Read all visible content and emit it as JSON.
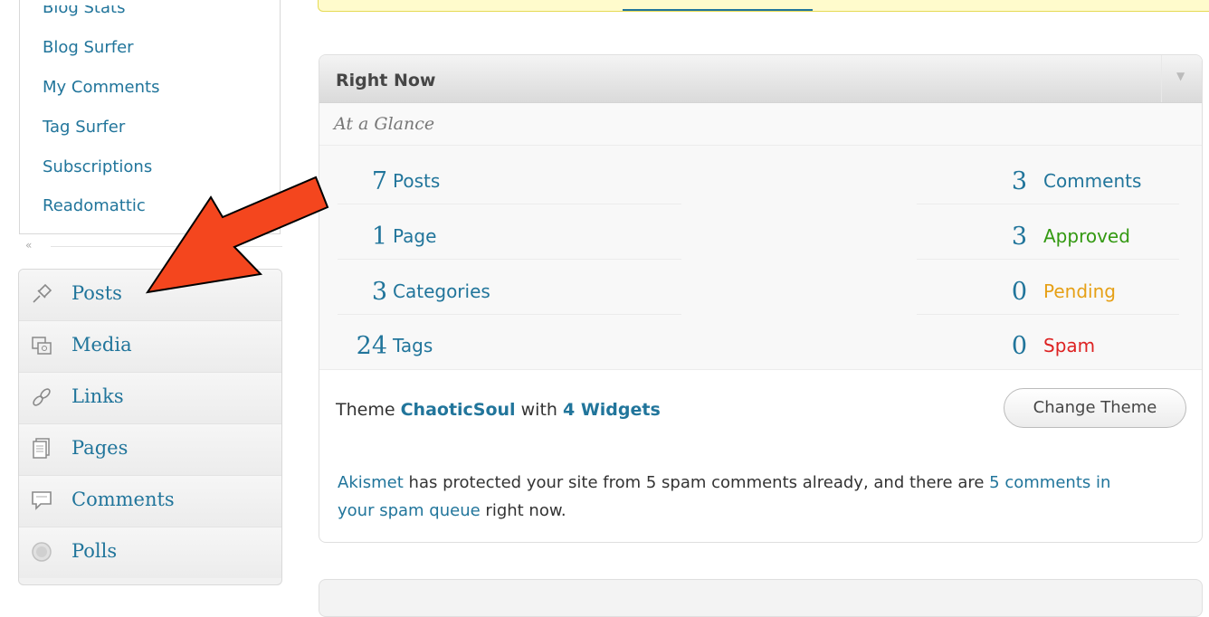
{
  "submenu": {
    "items": [
      {
        "label": "Blog Stats"
      },
      {
        "label": "Blog Surfer"
      },
      {
        "label": "My Comments"
      },
      {
        "label": "Tag Surfer"
      },
      {
        "label": "Subscriptions"
      },
      {
        "label": "Readomattic"
      }
    ],
    "collapse": "«"
  },
  "menu": {
    "items": [
      {
        "label": "Posts",
        "icon": "pin-icon"
      },
      {
        "label": "Media",
        "icon": "media-icon"
      },
      {
        "label": "Links",
        "icon": "link-icon"
      },
      {
        "label": "Pages",
        "icon": "pages-icon"
      },
      {
        "label": "Comments",
        "icon": "comment-icon"
      },
      {
        "label": "Polls",
        "icon": "poll-icon"
      }
    ]
  },
  "right_now": {
    "title": "Right Now",
    "toggle": "▼",
    "subtitle": "At a Glance",
    "content": [
      {
        "count": "7",
        "label": "Posts"
      },
      {
        "count": "1",
        "label": "Page"
      },
      {
        "count": "3",
        "label": "Categories"
      },
      {
        "count": "24",
        "label": "Tags"
      }
    ],
    "discussion": [
      {
        "count": "3",
        "label": "Comments",
        "status": "default"
      },
      {
        "count": "3",
        "label": "Approved",
        "status": "approved"
      },
      {
        "count": "0",
        "label": "Pending",
        "status": "pending"
      },
      {
        "count": "0",
        "label": "Spam",
        "status": "spam"
      }
    ],
    "theme": {
      "prefix": "Theme",
      "name": "ChaoticSoul",
      "with": "with",
      "widgets": "4 Widgets",
      "button": "Change Theme"
    },
    "akismet": {
      "link": "Akismet",
      "text1": "has protected your site from 5 spam comments already, and there are",
      "queue_link_1": "5",
      "queue_link_2": "comments in your spam queue",
      "text2": "right now."
    }
  },
  "colors": {
    "link": "#21759b",
    "approved": "#339911",
    "pending": "#e6a016",
    "spam": "#dd2222",
    "arrow": "#f4461e"
  }
}
